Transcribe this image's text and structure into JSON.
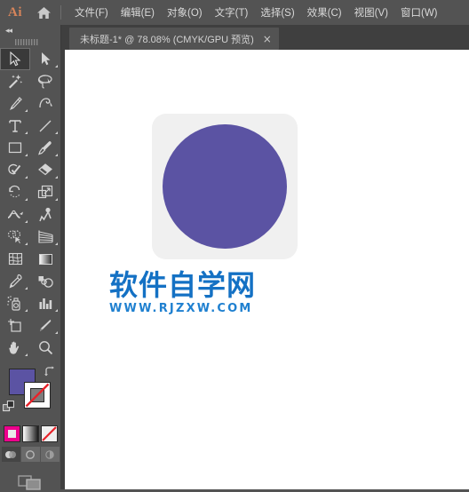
{
  "app": {
    "name": "Ai",
    "logo_color": "#d6845a"
  },
  "menubar": {
    "home_icon": "home-icon",
    "items": [
      {
        "label": "文件(F)",
        "name": "menu-file"
      },
      {
        "label": "编辑(E)",
        "name": "menu-edit"
      },
      {
        "label": "对象(O)",
        "name": "menu-object"
      },
      {
        "label": "文字(T)",
        "name": "menu-type"
      },
      {
        "label": "选择(S)",
        "name": "menu-select"
      },
      {
        "label": "效果(C)",
        "name": "menu-effect"
      },
      {
        "label": "视图(V)",
        "name": "menu-view"
      },
      {
        "label": "窗口(W)",
        "name": "menu-window"
      }
    ]
  },
  "tab": {
    "title": "未标题-1* @ 78.08% (CMYK/GPU 预览)",
    "close": "×",
    "document_name": "未标题-1*",
    "zoom": "78.08%",
    "mode": "CMYK/GPU 预览"
  },
  "toolpanel": {
    "collapse_icon": "◂◂",
    "tools": [
      {
        "name": "selection-tool",
        "active": true,
        "corner": false
      },
      {
        "name": "direct-selection-tool",
        "active": false,
        "corner": true
      },
      {
        "name": "magic-wand-tool",
        "active": false,
        "corner": false
      },
      {
        "name": "lasso-tool",
        "active": false,
        "corner": false
      },
      {
        "name": "pen-tool",
        "active": false,
        "corner": true
      },
      {
        "name": "curvature-tool",
        "active": false,
        "corner": false
      },
      {
        "name": "type-tool",
        "active": false,
        "corner": true
      },
      {
        "name": "line-segment-tool",
        "active": false,
        "corner": true
      },
      {
        "name": "rectangle-tool",
        "active": false,
        "corner": true
      },
      {
        "name": "paintbrush-tool",
        "active": false,
        "corner": true
      },
      {
        "name": "shaper-tool",
        "active": false,
        "corner": true
      },
      {
        "name": "eraser-tool",
        "active": false,
        "corner": true
      },
      {
        "name": "rotate-tool",
        "active": false,
        "corner": true
      },
      {
        "name": "scale-tool",
        "active": false,
        "corner": true
      },
      {
        "name": "width-tool",
        "active": false,
        "corner": true
      },
      {
        "name": "free-transform-tool",
        "active": false,
        "corner": false
      },
      {
        "name": "shape-builder-tool",
        "active": false,
        "corner": true
      },
      {
        "name": "perspective-grid-tool",
        "active": false,
        "corner": true
      },
      {
        "name": "mesh-tool",
        "active": false,
        "corner": false
      },
      {
        "name": "gradient-tool",
        "active": false,
        "corner": false
      },
      {
        "name": "eyedropper-tool",
        "active": false,
        "corner": true
      },
      {
        "name": "blend-tool",
        "active": false,
        "corner": false
      },
      {
        "name": "symbol-sprayer-tool",
        "active": false,
        "corner": true
      },
      {
        "name": "column-graph-tool",
        "active": false,
        "corner": true
      },
      {
        "name": "artboard-tool",
        "active": false,
        "corner": false
      },
      {
        "name": "slice-tool",
        "active": false,
        "corner": true
      },
      {
        "name": "hand-tool",
        "active": false,
        "corner": true
      },
      {
        "name": "zoom-tool",
        "active": false,
        "corner": false
      }
    ],
    "fill_color": "#5b53a3",
    "stroke_color": "#ffffff",
    "stroke_none": true,
    "swap_icon": "swap-fill-stroke-icon",
    "default_icon": "default-fill-stroke-icon",
    "fill_modes": [
      {
        "name": "color-button",
        "type": "color",
        "color": "#ec008c"
      },
      {
        "name": "gradient-button",
        "type": "gradient"
      },
      {
        "name": "none-button",
        "type": "none"
      }
    ],
    "draw_modes": [
      {
        "name": "draw-normal-button",
        "selected": true
      },
      {
        "name": "draw-behind-button",
        "selected": false
      },
      {
        "name": "draw-inside-button",
        "selected": false
      }
    ],
    "screen_mode": "change-screen-mode-button"
  },
  "canvas": {
    "artwork": {
      "card_name": "rounded-square-shape",
      "card_color": "#f0f0f0",
      "circle_name": "ellipse-shape",
      "circle_color": "#5b53a3"
    }
  },
  "watermark": {
    "cn": "软件自学网",
    "en": "WWW.RJZXW.COM",
    "color": "#1471c4"
  }
}
